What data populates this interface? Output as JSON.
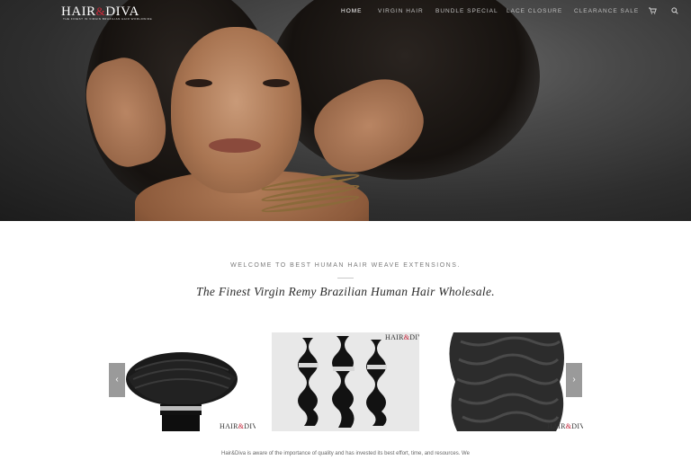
{
  "brand": {
    "logo_left": "HAIR",
    "logo_amp": "&",
    "logo_right": "DIVA",
    "tagline": "THE FINEST IN VIRGIN BRAZILIAN HAIR WORLDWIDE"
  },
  "nav": {
    "items": [
      {
        "label": "HOME",
        "active": true
      },
      {
        "label": "VIRGIN HAIR",
        "active": false
      },
      {
        "label": "BUNDLE SPECIAL",
        "active": false
      },
      {
        "label": "LACE CLOSURE",
        "active": false
      },
      {
        "label": "CLEARANCE SALE",
        "active": false
      }
    ],
    "cart_icon": "cart-icon",
    "search_icon": "search-icon"
  },
  "main": {
    "welcome": "WELCOME TO BEST HUMAN HAIR WEAVE EXTENSIONS.",
    "headline": "The Finest Virgin Remy Brazilian Human Hair Wholesale.",
    "intro": "Hair&Diva is aware of the importance of quality and has invested its best effort, time, and resources. We"
  },
  "carousel": {
    "prev_glyph": "‹",
    "next_glyph": "›",
    "badges": [
      {
        "left": "HAIR",
        "amp": "&",
        "right": "DIVA"
      },
      {
        "left": "HAIR",
        "amp": "&",
        "right": "DIVA"
      },
      {
        "left": "HAIR",
        "amp": "&",
        "right": "DIVA"
      }
    ]
  },
  "colors": {
    "accent": "#d0283a",
    "nav_text": "#bfbfbf",
    "arrow_bg": "#9a9a9a"
  }
}
